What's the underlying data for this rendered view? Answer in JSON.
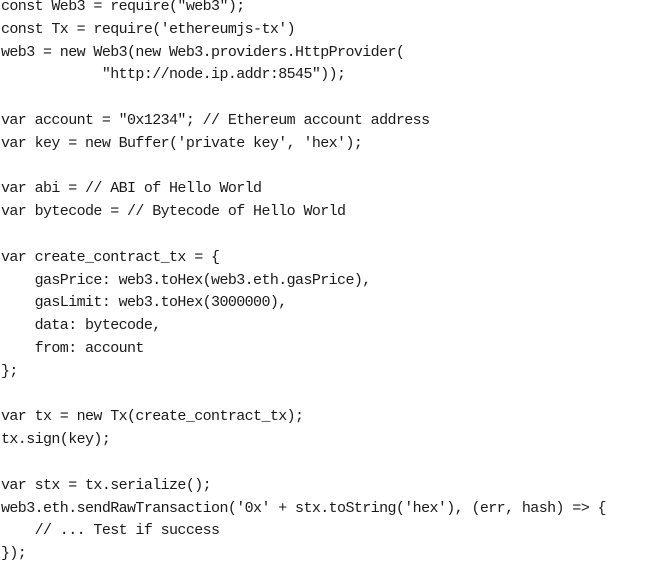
{
  "code_lines": [
    "const Web3 = require(\"web3\");",
    "const Tx = require('ethereumjs-tx')",
    "web3 = new Web3(new Web3.providers.HttpProvider(",
    "            \"http://node.ip.addr:8545\"));",
    "",
    "var account = \"0x1234\"; // Ethereum account address",
    "var key = new Buffer('private key', 'hex');",
    "",
    "var abi = // ABI of Hello World",
    "var bytecode = // Bytecode of Hello World",
    "",
    "var create_contract_tx = {",
    "    gasPrice: web3.toHex(web3.eth.gasPrice),",
    "    gasLimit: web3.toHex(3000000),",
    "    data: bytecode,",
    "    from: account",
    "};",
    "",
    "var tx = new Tx(create_contract_tx);",
    "tx.sign(key);",
    "",
    "var stx = tx.serialize();",
    "web3.eth.sendRawTransaction('0x' + stx.toString('hex'), (err, hash) => {",
    "    // ... Test if success",
    "});"
  ]
}
